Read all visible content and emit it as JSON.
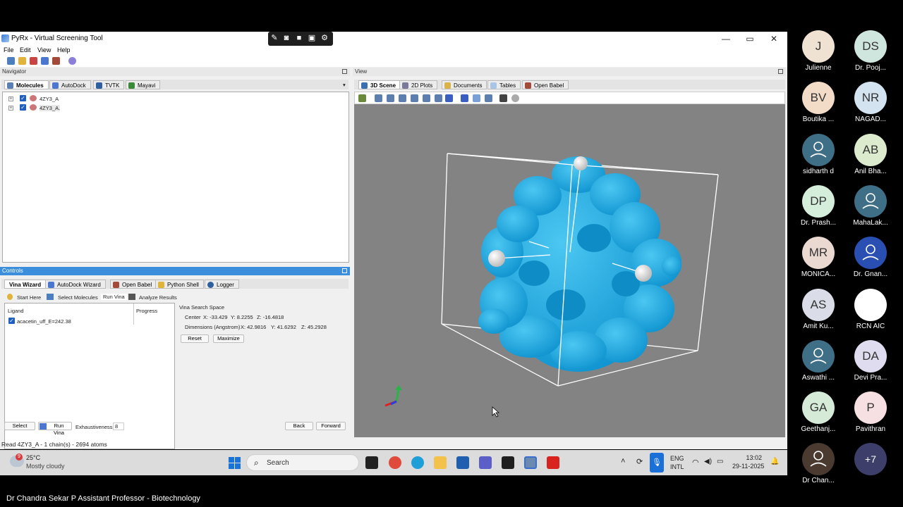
{
  "window": {
    "title": "PyRx - Virtual Screening Tool",
    "controls": [
      "—",
      "▭",
      "✕"
    ]
  },
  "menu": [
    "File",
    "Edit",
    "View",
    "Help"
  ],
  "recording_toolbar": [
    "pen-icon",
    "camera-icon",
    "video-icon",
    "copy-icon",
    "gear-icon"
  ],
  "navigator": {
    "header": "Navigator",
    "tabs": [
      "Molecules",
      "AutoDock",
      "TVTK",
      "Mayavi"
    ],
    "molecules": [
      "4ZY3_A",
      "4ZY3_A."
    ]
  },
  "controls": {
    "header": "Controls",
    "tabs": [
      "Vina Wizard",
      "AutoDock Wizard",
      "Open Babel",
      "Python Shell",
      "Logger"
    ],
    "steps": [
      "Start Here",
      "Select Molecules",
      "Run Vina",
      "Analyze Results"
    ],
    "table_headers": [
      "Ligand",
      "Progress"
    ],
    "ligands": [
      "acacetin_uff_E=242.38"
    ],
    "search_space": {
      "title": "Vina Search Space",
      "center_label": "Center",
      "center_x": "X: -33.429",
      "center_y": "Y: 8.2255",
      "center_z": "Z: -16.4818",
      "dims_label": "Dimensions (Angstrom)",
      "dim_x": "X: 42.9816",
      "dim_y": "Y: 41.6292",
      "dim_z": "Z: 45.2928",
      "reset": "Reset",
      "maximize": "Maximize"
    },
    "bottom": {
      "select": "Select",
      "run_vina": "Run Vina",
      "exhaustiveness_label": "Exhaustiveness:",
      "exhaustiveness_value": "8",
      "back": "Back",
      "forward": "Forward"
    }
  },
  "view": {
    "header": "View",
    "tabs": [
      "3D Scene",
      "2D Plots",
      "Documents",
      "Tables",
      "Open Babel"
    ],
    "scene_colors": {
      "background": "#838383",
      "protein": "#1fa9e0",
      "box": "#ffffff"
    }
  },
  "status": "Read 4ZY3_A - 1 chain(s) - 2694 atoms",
  "taskbar": {
    "weather_temp": "25°C",
    "weather_desc": "Mostly cloudy",
    "weather_badge": "9",
    "search_placeholder": "Search",
    "lang_top": "ENG",
    "lang_bottom": "INTL",
    "time": "13:02",
    "date": "29-11-2025"
  },
  "participants": [
    {
      "initials": "J",
      "name": "Julienne",
      "bg": "#efe2d2"
    },
    {
      "initials": "DS",
      "name": "Dr. Pooj...",
      "bg": "#cfe6de"
    },
    {
      "initials": "BV",
      "name": "Boutika ...",
      "bg": "#f3dcc7"
    },
    {
      "initials": "NR",
      "name": "NAGAD...",
      "bg": "#d3e3ef"
    },
    {
      "initials": "",
      "name": "sidharth d",
      "bg": "#3f6f86"
    },
    {
      "initials": "AB",
      "name": "Anil  Bha...",
      "bg": "#dcebcd"
    },
    {
      "initials": "DP",
      "name": "Dr. Prash...",
      "bg": "#d4eedb"
    },
    {
      "initials": "",
      "name": "MahaLak...",
      "bg": "#3f6f86"
    },
    {
      "initials": "MR",
      "name": "MONICA...",
      "bg": "#ead9d0"
    },
    {
      "initials": "",
      "name": "Dr. Gnan...",
      "bg": "#2a4fb3"
    },
    {
      "initials": "AS",
      "name": "Amit Ku...",
      "bg": "#dadde8"
    },
    {
      "initials": "",
      "name": "RCN  AIC",
      "bg": "#ffffff"
    },
    {
      "initials": "",
      "name": "Aswathi ...",
      "bg": "#3f6f86"
    },
    {
      "initials": "DA",
      "name": "Devi Pra...",
      "bg": "#e0dcef"
    },
    {
      "initials": "GA",
      "name": "Geethanj...",
      "bg": "#d6ead8"
    },
    {
      "initials": "P",
      "name": "Pavithran",
      "bg": "#f6e0e2"
    },
    {
      "initials": "",
      "name": "Dr Chan...",
      "bg": "#4a3a30"
    },
    {
      "initials": "+7",
      "name": "",
      "bg": "#3e3e6a"
    }
  ],
  "caption": "Dr Chandra Sekar P Assistant Professor - Biotechnology"
}
